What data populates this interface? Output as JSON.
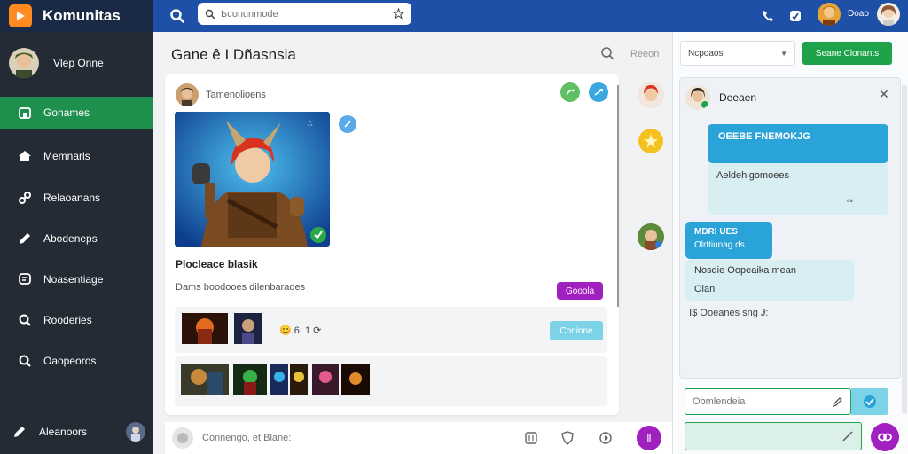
{
  "app": {
    "name": "Komunitas"
  },
  "topbar": {
    "search_placeholder": "Ьсопunmode",
    "user_name": "Doao"
  },
  "sidebar": {
    "user_name": "Vlep Onne",
    "items": [
      {
        "label": "Gonames",
        "icon": "home-icon",
        "active": true
      },
      {
        "label": "Memnarls",
        "icon": "house-icon",
        "active": false
      },
      {
        "label": "Relaoanans",
        "icon": "link-icon",
        "active": false
      },
      {
        "label": "Abodeneps",
        "icon": "pen-icon",
        "active": false
      },
      {
        "label": "Noasentiage",
        "icon": "chat-icon",
        "active": false
      },
      {
        "label": "Rooderies",
        "icon": "search-icon",
        "active": false
      },
      {
        "label": "Oaopeoros",
        "icon": "search-icon",
        "active": false
      }
    ],
    "bottom_label": "Aleanoors"
  },
  "main": {
    "title": "Gane ê I Dñasnsia",
    "search_label": "Reeon",
    "post": {
      "author": "Tamenolioens",
      "title": "Plocleace blasik",
      "subtitle": "Dams boodooes dilenbarades",
      "tag_label": "Gooola",
      "meta_text": "😊 6: 1 ⟳",
      "action_label": "Coninne"
    },
    "composer_placeholder": "Connengo, et Blane:",
    "composer_send_label": "Ⅱ"
  },
  "right": {
    "filter_value": "Ncpoaos",
    "action_button": "Seane Clonants",
    "chat": {
      "title": "Deeaen",
      "messages": [
        {
          "header": "OEEBE FNEMOKJG",
          "body": "Aeldehigomoees",
          "time": "⁴⁸",
          "side": "right"
        },
        {
          "header": "MDRI UES",
          "body": "Olrttiunag.ds.",
          "side": "left"
        },
        {
          "header": "",
          "body": "Nosdie Oopeaika mean",
          "body2": "Oian",
          "side": "left"
        }
      ],
      "note": "Ⅰ$ Ooeanes sng Ɉ:",
      "input_placeholder": "Obmlendeia"
    }
  },
  "colors": {
    "topbar": "#1f50a7",
    "sidebar": "#252b35",
    "active": "#1f8f4e",
    "accent_purple": "#a020c0",
    "accent_cyan": "#7cd3e8",
    "accent_green": "#1ea34a"
  }
}
